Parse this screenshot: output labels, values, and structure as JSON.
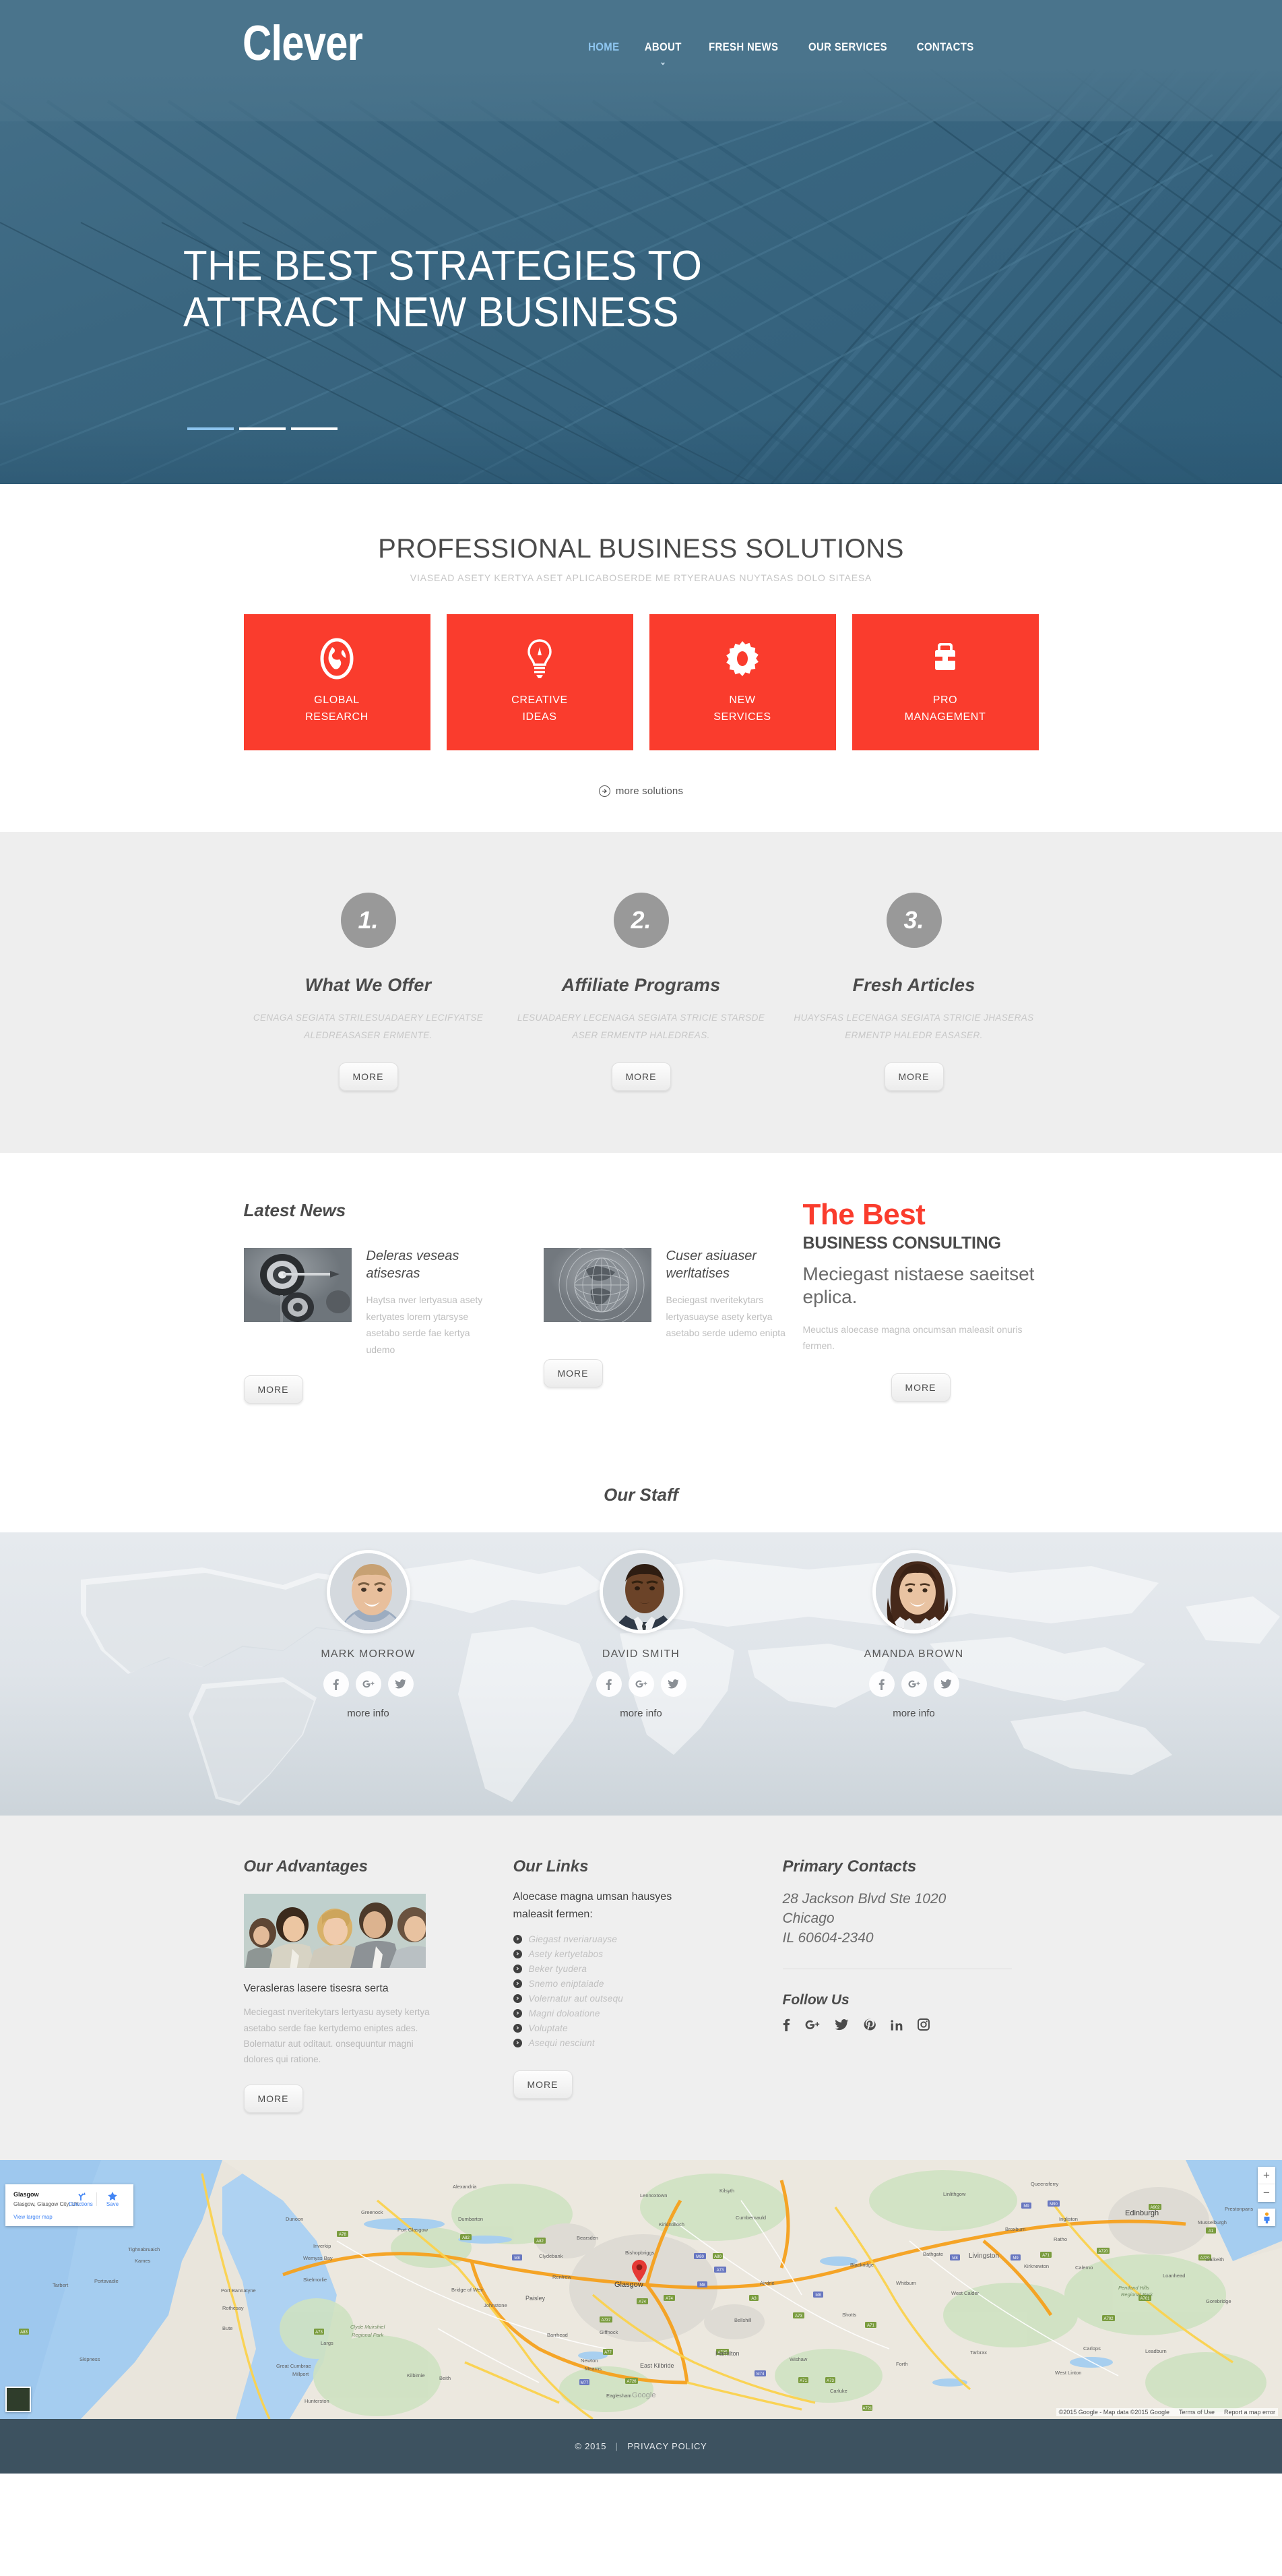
{
  "header": {
    "brand": "Clever",
    "nav": [
      {
        "label": "HOME",
        "active": true,
        "caret": false
      },
      {
        "label": "ABOUT",
        "active": false,
        "caret": true
      },
      {
        "label": "FRESH NEWS",
        "active": false,
        "caret": false
      },
      {
        "label": "OUR SERVICES",
        "active": false,
        "caret": false
      },
      {
        "label": "CONTACTS",
        "active": false,
        "caret": false
      }
    ]
  },
  "hero": {
    "title_line1": "THE BEST STRATEGIES TO",
    "title_line2": "ATTRACT NEW BUSINESS",
    "slides": 3,
    "active_slide": 1
  },
  "solutions": {
    "title": "PROFESSIONAL BUSINESS SOLUTIONS",
    "subtitle": "VIASEAD ASETY KERTYA ASET APLICABOSERDE ME RTYERAUAS NUYTASAS DOLO SITAESA",
    "cards": [
      {
        "icon": "globe-icon",
        "line1": "GLOBAL",
        "line2": "RESEARCH"
      },
      {
        "icon": "lightbulb-icon",
        "line1": "CREATIVE",
        "line2": "IDEAS"
      },
      {
        "icon": "gear-icon",
        "line1": "NEW",
        "line2": "SERVICES"
      },
      {
        "icon": "briefcase-icon",
        "line1": "PRO",
        "line2": "MANAGEMENT"
      }
    ],
    "more_label": "more solutions"
  },
  "steps": [
    {
      "num": "1.",
      "title": "What We Offer",
      "text": "CENAGA SEGIATA STRILESUADAERY LECIFYATSE ALEDREASASER ERMENTE.",
      "button": "MORE"
    },
    {
      "num": "2.",
      "title": "Affiliate Programs",
      "text": "LESUADAERY LECENAGA SEGIATA STRICIE STARSDE ASER ERMENTP HALEDREAS.",
      "button": "MORE"
    },
    {
      "num": "3.",
      "title": "Fresh Articles",
      "text": "HUAYSFAS LECENAGA SEGIATA STRICIE JHASERAS ERMENTP HALEDR EASASER.",
      "button": "MORE"
    }
  ],
  "news": {
    "heading": "Latest News",
    "items": [
      {
        "thumb": "dartboard-photo",
        "title": "Deleras veseas atisesras",
        "text": "Haytsa nver lertyasua asety kertyates lorem ytarsyse asetabo serde fae kertya udemo",
        "button": "MORE"
      },
      {
        "thumb": "globe-photo",
        "title": "Cuser asiuaser werltatises",
        "text": "Beciegast nveritekytars lertyasuayse asety kertya asetabo serde udemo enipta",
        "button": "MORE"
      }
    ],
    "promo": {
      "line1": "The Best",
      "line2": "BUSINESS CONSULTING",
      "line3": "Meciegast nistaese saeitset eplica.",
      "line4": "Meuctus aloecase magna oncumsan maleasit onuris fermen.",
      "button": "MORE"
    }
  },
  "staff": {
    "heading": "Our Staff",
    "members": [
      {
        "name": "MARK MORROW",
        "more": "more info",
        "socials": [
          "facebook-icon",
          "google-plus-icon",
          "twitter-icon"
        ],
        "photo": "man-blond-photo"
      },
      {
        "name": "DAVID SMITH",
        "more": "more info",
        "socials": [
          "facebook-icon",
          "google-plus-icon",
          "twitter-icon"
        ],
        "photo": "man-suit-photo"
      },
      {
        "name": "AMANDA BROWN",
        "more": "more info",
        "socials": [
          "facebook-icon",
          "google-plus-icon",
          "twitter-icon"
        ],
        "photo": "woman-photo"
      }
    ]
  },
  "footer": {
    "advantages": {
      "heading": "Our Advantages",
      "image": "business-team-photo",
      "subtitle": "Verasleras lasere tisesra serta",
      "text": "Meciegast nveritekytars lertyasu aysety kertya asetabo serde fae kertydemo eniptes ades. Bolernatur aut oditaut. onsequuntur magni dolores qui ratione.",
      "button": "MORE"
    },
    "links": {
      "heading": "Our Links",
      "intro": "Aloecase magna umsan hausyes maleasit fermen:",
      "items": [
        "Giegast nveriaruayse",
        "Asety kertyetabos",
        "Beker tyudera",
        "Snemo eniptaiade",
        "Volernatur aut outsequ",
        "Magni doloatione",
        "Voluptate",
        "Asequi nesciunt"
      ],
      "button": "MORE"
    },
    "contacts": {
      "heading": "Primary Contacts",
      "address_line1": "28 Jackson Blvd Ste 1020",
      "address_line2": "Chicago",
      "address_line3": "IL 60604-2340",
      "follow_heading": "Follow Us",
      "socials": [
        "facebook-icon",
        "google-plus-icon",
        "twitter-icon",
        "pinterest-icon",
        "linkedin-icon",
        "instagram-icon"
      ]
    }
  },
  "map": {
    "card_title": "Glasgow",
    "card_subtitle": "Glasgow, Glasgow City, UK",
    "card_link": "View larger map",
    "directions_label": "Directions",
    "save_label": "Save",
    "attribution": "©2015 Google - Map data ©2015 Google",
    "terms": "Terms of Use",
    "report": "Report a map error",
    "zoom_in": "+",
    "zoom_out": "−",
    "labels": [
      "Alexandria",
      "Lennoxtown",
      "Kilsyth",
      "Queensferry",
      "Linlithgow",
      "Edinburgh",
      "Prestonpans",
      "Dunoon",
      "Greenock",
      "Dumbarton",
      "Kirkintilloch",
      "Cumbernauld",
      "Ingliston",
      "Musselburgh",
      "Port Glasgow",
      "Bearsden",
      "Broxburn",
      "Ratho",
      "Inverkip",
      "Clydebank",
      "Bishopbriggs",
      "Tighnabruaich",
      "Kames",
      "Wemyss Bay",
      "Renfrew",
      "Bathgate",
      "Livingston",
      "Blackridge",
      "Portavadie",
      "Skelmorlie",
      "Glasgow",
      "Airdrie",
      "Whitburn",
      "Kirknewton",
      "Calerno",
      "Tarbert",
      "Bridge of Weir",
      "Paisley",
      "West Calder",
      "Loanhead",
      "Dalkeith",
      "Port Bannatyne",
      "Johnstone",
      "Shotts",
      "Pentland Hills Regional Park",
      "Gorebridge",
      "Rothesay",
      "Clyde Muirshiel Regional Park",
      "Bellshill",
      "Barrhead",
      "Giffnock",
      "Bute",
      "Largs",
      "Hamilton",
      "Wishaw",
      "Tarbrax",
      "Carlops",
      "Leadburn",
      "Skipness",
      "Great Cumbrae",
      "Millport",
      "Newton Mearns",
      "East Kilbride",
      "Forth",
      "West Linton",
      "Kilbirnie",
      "Beith",
      "Eaglesham",
      "Carluke",
      "Hunterston"
    ]
  },
  "bottom": {
    "copyright": "© 2015",
    "separator": "|",
    "privacy": "PRIVACY POLICY"
  }
}
